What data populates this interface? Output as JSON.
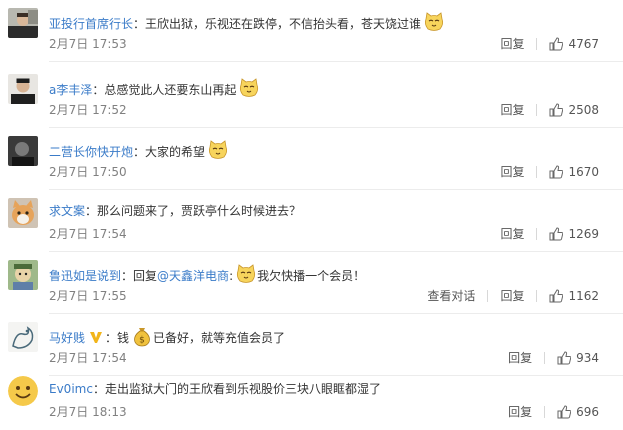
{
  "comments": [
    {
      "avatar": "avatar-man-photo",
      "user": "亚投行首席行长",
      "separator": "：",
      "text": "王欣出狱，乐视还在跌停，不信抬头看，苍天饶过谁",
      "emoji": "cat-face-icon",
      "date": "2月7日 17:53",
      "reply_label": "回复",
      "likes": "4767"
    },
    {
      "avatar": "avatar-man-photo-2",
      "user": "a李丰泽",
      "separator": "：",
      "text": "总感觉此人还要东山再起",
      "emoji": "cat-face-icon",
      "date": "2月7日 17:52",
      "reply_label": "回复",
      "likes": "2508"
    },
    {
      "avatar": "avatar-dark-portrait",
      "user": "二营长你快开炮",
      "separator": "：",
      "text": "大家的希望",
      "emoji": "cat-face-icon",
      "date": "2月7日 17:50",
      "reply_label": "回复",
      "likes": "1670"
    },
    {
      "avatar": "avatar-cat-photo",
      "user": "求文案",
      "separator": "：",
      "text": "那么问题来了，贾跃亭什么时候进去？",
      "date": "2月7日 17:54",
      "reply_label": "回复",
      "likes": "1269"
    },
    {
      "avatar": "avatar-cartoon",
      "user": "鲁迅如是说到",
      "separator": "：",
      "text_prefix": "回复",
      "mention": "@天鑫洋电商",
      "mention_sep": ":",
      "emoji": "cat-face-icon",
      "text": "我欠快播一个会员！",
      "date": "2月7日 17:55",
      "view_thread_label": "查看对话",
      "reply_label": "回复",
      "likes": "1162"
    },
    {
      "avatar": "avatar-dragon-sketch",
      "user": "马好贱",
      "badge": "vip-heart-badge-icon",
      "separator": "：",
      "text_prefix": "钱",
      "emoji": "money-bag-icon",
      "text": "已备好，就等充值会员了",
      "date": "2月7日 17:54",
      "reply_label": "回复",
      "likes": "934"
    },
    {
      "avatar": "avatar-smiley",
      "user": "Ev0imc",
      "separator": "：",
      "text": "走出监狱大门的王欣看到乐视股价三块八眼眶都湿了",
      "date": "2月7日 18:13",
      "reply_label": "回复",
      "likes": "696"
    }
  ]
}
